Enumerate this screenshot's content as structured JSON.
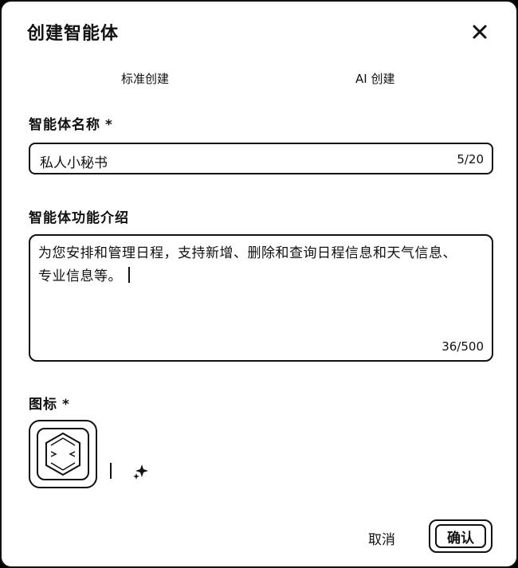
{
  "dialog": {
    "title": "创建智能体",
    "close_icon": "close-icon"
  },
  "tabs": [
    {
      "label": "标准创建"
    },
    {
      "label": "AI 创建"
    }
  ],
  "name_field": {
    "label": "智能体名称",
    "required_mark": "*",
    "value": "私人小秘书",
    "counter": "5/20"
  },
  "desc_field": {
    "label": "智能体功能介绍",
    "value": "为您安排和管理日程，支持新增、删除和查询日程信息和天气信息、专业信息等。",
    "counter": "36/500"
  },
  "icon_field": {
    "label": "图标",
    "required_mark": "*",
    "icon": "hexagon-avatar-icon",
    "ai_generate_icon": "sparkle-icon"
  },
  "footer": {
    "cancel_label": "取消",
    "confirm_label": "确认"
  }
}
